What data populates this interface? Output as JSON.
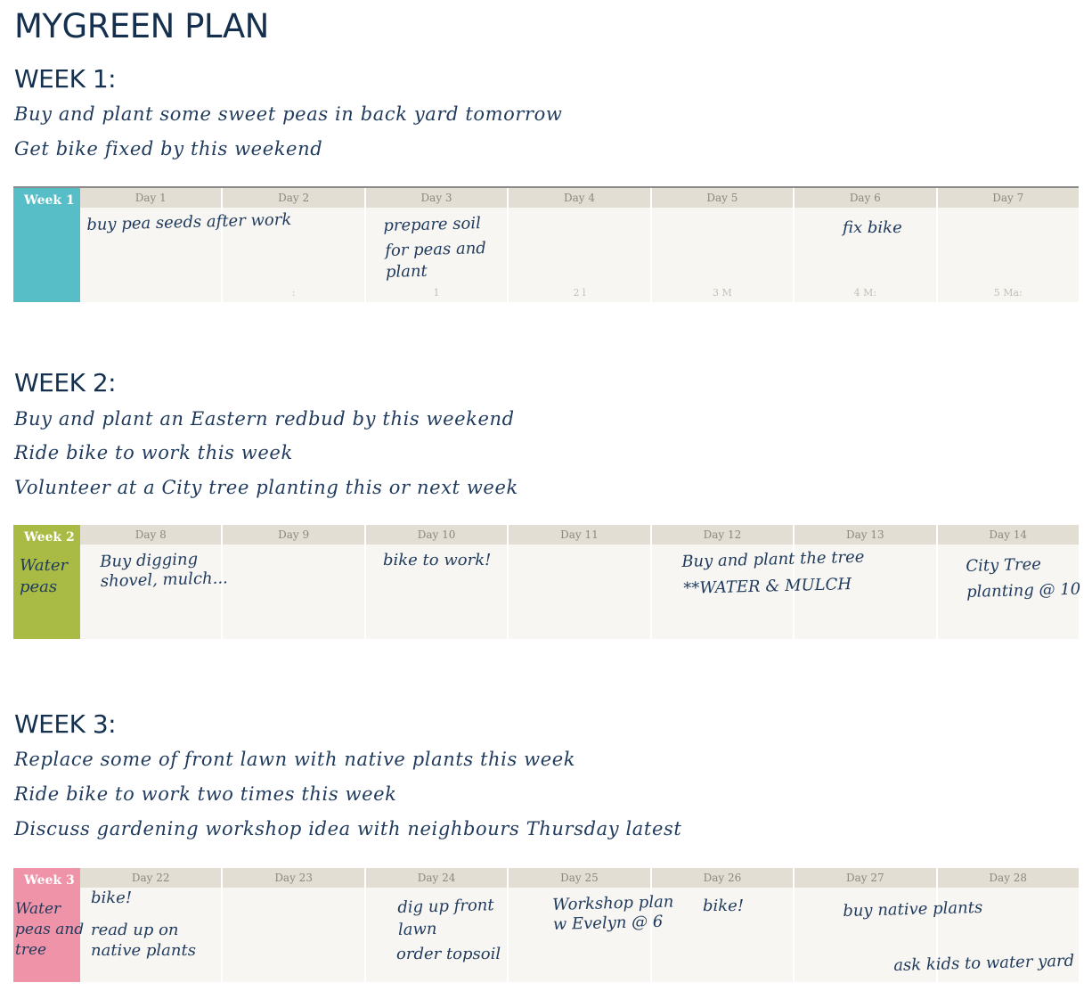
{
  "title": "MYGREEN PLAN",
  "weeks": [
    {
      "heading": "WEEK 1:",
      "goals": [
        "Buy and plant some sweet peas in back yard tomorrow",
        "Get bike fixed by this weekend"
      ],
      "grid_label": "Week 1",
      "grid_color": "#57bdc6",
      "week_note": "",
      "days": [
        {
          "label": "Day 1",
          "foot": ""
        },
        {
          "label": "Day 2",
          "foot": ":"
        },
        {
          "label": "Day 3",
          "foot": "1"
        },
        {
          "label": "Day 4",
          "foot": "2 l"
        },
        {
          "label": "Day 5",
          "foot": "3 M"
        },
        {
          "label": "Day 6",
          "foot": "4 M:"
        },
        {
          "label": "Day 7",
          "foot": "5 Ma:"
        }
      ],
      "notes": [
        "buy pea seeds after work",
        "prepare soil",
        "for peas and\nplant",
        "fix bike"
      ]
    },
    {
      "heading": "WEEK 2:",
      "goals": [
        "Buy and plant an Eastern redbud by this weekend",
        "Ride bike to work this week",
        "Volunteer at a City tree planting this or next week"
      ],
      "grid_label": "Week 2",
      "grid_color": "#a9bb45",
      "week_note": "Water\npeas",
      "days": [
        {
          "label": "Day 8",
          "foot": ""
        },
        {
          "label": "Day 9",
          "foot": ""
        },
        {
          "label": "Day 10",
          "foot": ""
        },
        {
          "label": "Day 11",
          "foot": ""
        },
        {
          "label": "Day 12",
          "foot": ""
        },
        {
          "label": "Day 13",
          "foot": ""
        },
        {
          "label": "Day 14",
          "foot": ""
        }
      ],
      "notes": [
        "Buy digging\nshovel, mulch...",
        "bike to work!",
        "Buy and plant the tree",
        "**WATER & MULCH",
        "City Tree\nplanting @ 10"
      ]
    },
    {
      "heading": "WEEK 3:",
      "goals": [
        "Replace some of front lawn with native plants this week",
        "Ride bike to work two times this week",
        "Discuss gardening workshop idea with neighbours Thursday latest"
      ],
      "grid_label": "Week 3",
      "grid_color": "#ef93a8",
      "week_note": "Water\npeas and\ntree",
      "days": [
        {
          "label": "Day 22",
          "foot": ""
        },
        {
          "label": "Day 23",
          "foot": ""
        },
        {
          "label": "Day 24",
          "foot": ""
        },
        {
          "label": "Day 25",
          "foot": ""
        },
        {
          "label": "Day 26",
          "foot": ""
        },
        {
          "label": "Day 27",
          "foot": ""
        },
        {
          "label": "Day 28",
          "foot": ""
        }
      ],
      "notes": [
        "bike!",
        "read up on\nnative plants",
        "dig up front\nlawn",
        "order topsoil",
        "Workshop plan\nw Evelyn @ 6",
        "bike!",
        "buy native plants",
        "ask kids to water yard"
      ]
    }
  ]
}
